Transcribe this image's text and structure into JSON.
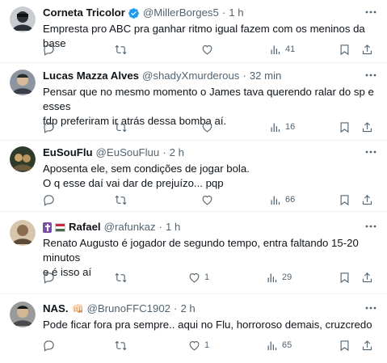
{
  "tweets": [
    {
      "name": "Corneta Tricolor",
      "handle": "@MillerBorges5",
      "dot": "·",
      "time": "1 h",
      "verified": true,
      "text": "Empresta pro ABC pra ganhar ritmo igual fazem com os meninos da base",
      "replies": "",
      "retweets": "",
      "likes": "",
      "views": "41",
      "avatar_color": "#2c3038"
    },
    {
      "name": "Lucas Mazza Alves",
      "handle": "@shadyXmurderous",
      "dot": "·",
      "time": "32 min",
      "verified": false,
      "text": "Pensar que no mesmo momento o James tava querendo ralar do sp e esses\nfdp preferiram ir atrás dessa bomba aí.",
      "replies": "",
      "retweets": "",
      "likes": "",
      "views": "16",
      "avatar_color": "#3a3f47"
    },
    {
      "name": "EuSouFlu",
      "handle": "@EuSouFluu",
      "dot": "·",
      "time": "2 h",
      "verified": false,
      "text": "Aposenta ele, sem condições de jogar bola.\nO q esse daí vai dar de prejuízo... pqp",
      "replies": "",
      "retweets": "",
      "likes": "",
      "views": "66",
      "avatar_color": "#6b5a3c"
    },
    {
      "name": "Rafael",
      "handle": "@rafunkaz",
      "dot": "·",
      "time": "1 h",
      "verified": false,
      "text": "Renato Augusto é jogador de segundo tempo, entra faltando 15-20 minutos\ne é isso aí",
      "replies": "",
      "retweets": "",
      "likes": "1",
      "views": "29",
      "avatar_color": "#8a6d4f"
    },
    {
      "name": "NAS.",
      "handle": "@BrunoFFC1902",
      "dot": "·",
      "time": "2 h",
      "verified": false,
      "text": "Pode ficar fora pra sempre.. aqui no Flu, horroroso demais, cruzcredo",
      "replies": "",
      "retweets": "",
      "likes": "1",
      "views": "65",
      "avatar_color": "#4a4a4a"
    }
  ],
  "colors": {
    "text_primary": "#0f1419",
    "text_secondary": "#536471",
    "verified_blue": "#1d9bf0",
    "divider": "#eff3f4"
  },
  "icons": {
    "reply": "reply-icon",
    "retweet": "retweet-icon",
    "like": "heart-icon",
    "views": "views-chart-icon",
    "bookmark": "bookmark-icon",
    "share": "share-icon",
    "more": "more-dots-icon"
  }
}
